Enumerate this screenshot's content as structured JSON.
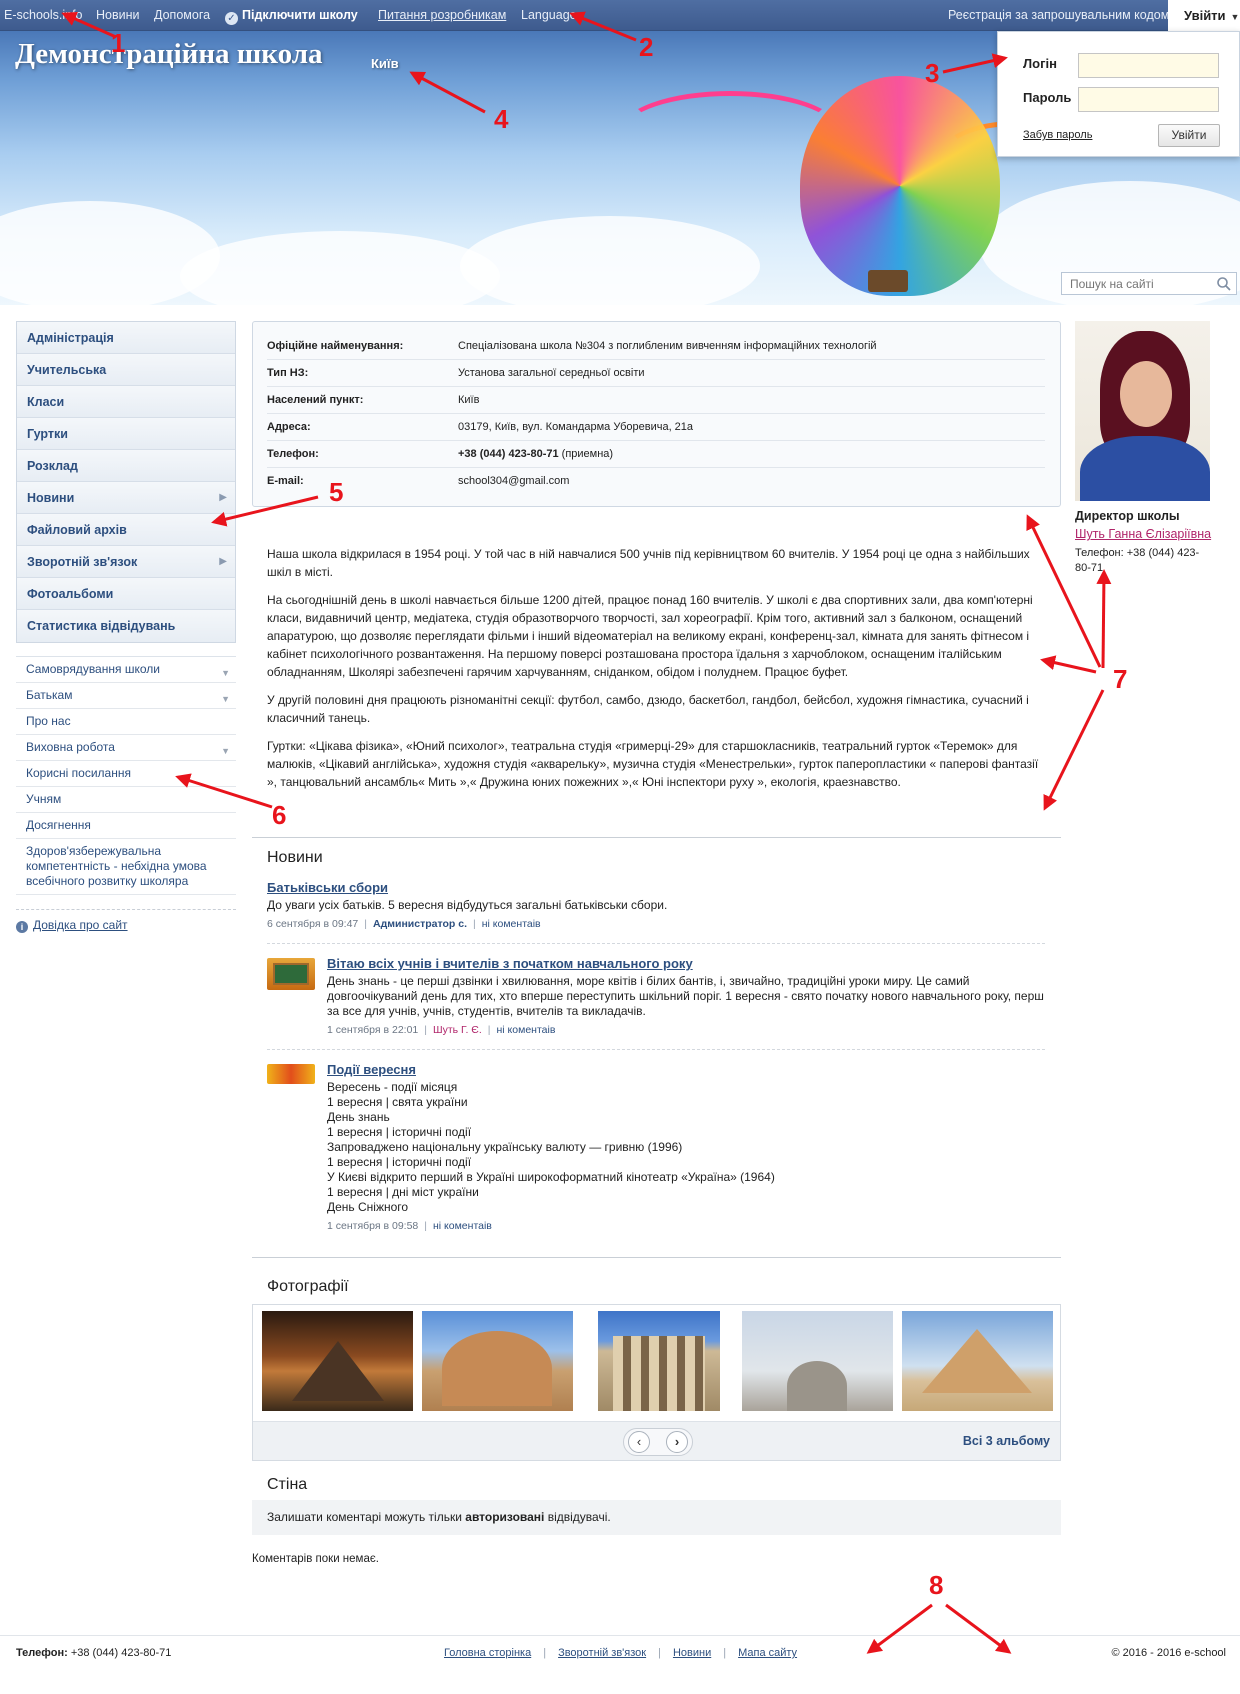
{
  "topbar": {
    "site": "E-schools.info",
    "news": "Новини",
    "help": "Допомога",
    "connect": "Підключити школу",
    "dev_questions": "Питання розробникам",
    "language": "Language",
    "register_invite": "Реєстрація за запрошувальним кодом",
    "login": "Увійти"
  },
  "school": {
    "title": "Демонстраційна школа",
    "city": "Київ"
  },
  "search": {
    "placeholder": "Пошук на сайті"
  },
  "login_form": {
    "login_label": "Логін",
    "password_label": "Пароль",
    "forgot": "Забув пароль",
    "submit": "Увійти"
  },
  "sidebar_main": [
    {
      "label": "Адміністрація"
    },
    {
      "label": "Учительська"
    },
    {
      "label": "Класи"
    },
    {
      "label": "Гуртки"
    },
    {
      "label": "Розклад"
    },
    {
      "label": "Новини"
    },
    {
      "label": "Файловий архів"
    },
    {
      "label": "Зворотній зв'язок"
    },
    {
      "label": "Фотоальбоми"
    },
    {
      "label": "Статистика відвідувань"
    }
  ],
  "sidebar_secondary": [
    {
      "label": "Самоврядування школи"
    },
    {
      "label": "Батькам"
    },
    {
      "label": "Про нас"
    },
    {
      "label": "Виховна робота"
    },
    {
      "label": "Корисні посилання"
    },
    {
      "label": "Учням"
    },
    {
      "label": "Досягнення"
    },
    {
      "label": "Здоров'язбережувальна компетентність - небхідна умова всебічного розвитку школяра"
    }
  ],
  "help_link": "Довідка про сайт",
  "info": {
    "rows": [
      {
        "key": "Офіційне найменування:",
        "value": "Спеціалізована школа №304 з поглибленим вивченням інформаційних технологій"
      },
      {
        "key": "Тип НЗ:",
        "value": "Установа загальної середньої освіти"
      },
      {
        "key": "Населений пункт:",
        "value": "Київ"
      },
      {
        "key": "Адреса:",
        "value": "03179, Київ, вул. Командарма Уборевича, 21а"
      },
      {
        "key": "Телефон:",
        "value_bold": "+38 (044) 423-80-71",
        "value_suffix": " (приемна)"
      },
      {
        "key": "E-mail:",
        "value": "school304@gmail.com"
      }
    ]
  },
  "director": {
    "title": "Директор школы",
    "name": "Шуть Ганна Єлізаріївна",
    "phone": "Телефон: +38 (044) 423-80-71"
  },
  "about": [
    "Наша школа відкрилася в 1954 році. У той час в ній навчалися 500 учнів під керівництвом 60 вчителів. У 1954 році це одна з найбільших шкіл в місті.",
    "На сьогоднішній день в школі навчається більше 1200 дітей, працює понад 160 вчителів. У школі є два спортивних зали, два комп'ютерні класи, видавничий центр, медіатека, студія образотворчого творчості, зал хореографії. Крім того, активний зал з балконом, оснащений апаратурою, що дозволяє переглядати фільми і інший відеоматеріал на великому екрані, конференц-зал, кімната для занять фітнесом і кабінет психологічного розвантаження. На першому поверсі розташована простора їдальня з харчоблоком, оснащеним італійським обладнанням, Школярі забезпечені гарячим харчуванням, сніданком, обідом і полуднем. Працює буфет.",
    "У другій половині дня працюють різноманітні секції: футбол, самбо, дзюдо, баскетбол, гандбол, бейсбол, художня гімнастика, сучасний і класичний танець.",
    "Гуртки: «Цікава фізика», «Юний психолог», театральна студія «гримерці-29» для старшокласників, театральний гурток «Теремок» для малюків, «Цікавий англійська», художня студія «акварельку», музична студія «Менестрельки», гурток паперопластики « паперові фантазії », танцювальний ансамбль« Мить »,« Дружина юних пожежних »,« Юні інспектори руху », екологія, краезнавство."
  ],
  "news": {
    "title": "Новини",
    "items": [
      {
        "title": "Батьківськи сбори",
        "body": [
          "До уваги усіх батьків. 5 вересня відбудуться загальні батьківськи сбори."
        ],
        "date": "6 сентября в 09:47",
        "author": "Администратор с.",
        "comments": "ні коментаів"
      },
      {
        "title": "Вітаю всіх учнів і вчителів з початком навчального року",
        "body": [
          "День знань - це перші дзвінки і хвилювання, море квітів і білих бантів, і, звичайно, традиційні уроки миру. Це самий довгоочікуваний день для тих, хто вперше переступить шкільний поріг. 1 вересня - свято початку нового навчального року, перш за все для учнів, учнів, студентів, вчителів та викладачів."
        ],
        "date": "1 сентября в 22:01",
        "author": "Шуть Г. Є.",
        "comments": "ні коментаів"
      },
      {
        "title": "Події вересня",
        "body": [
          "Вересень - події місяця",
          "1 вересня | свята україни",
          "День знань",
          "1 вересня | історичні події",
          "Запроваджено національну українську валюту — гривню (1996)",
          "1 вересня | історичні події",
          "У Києві відкрито перший в Україні широкоформатний кінотеатр «Україна» (1964)",
          "1 вересня | дні міст україни",
          "День Сніжного"
        ],
        "date": "1 сентября в 09:58",
        "comments": "ні коментаів"
      }
    ]
  },
  "photos": {
    "title": "Фотографії",
    "all_albums": "Всі 3 альбому"
  },
  "wall": {
    "title": "Стіна",
    "note_prefix": "Залишати коментарі можуть тільки ",
    "note_bold": "авторизовані",
    "note_suffix": " відвідувачі.",
    "no_comments": "Коментарів поки немає."
  },
  "footer": {
    "phone_label": "Телефон:",
    "phone": " +38 (044) 423-80-71",
    "links": [
      "Головна сторінка",
      "Зворотній зв'язок",
      "Новини",
      "Мапа сайту"
    ],
    "copyright": "© 2016 - 2016 e-school"
  },
  "annotations": [
    "1",
    "2",
    "3",
    "4",
    "5",
    "6",
    "7",
    "8"
  ],
  "colors": {
    "accent": "#3e5b8e",
    "link": "#2d4f7f",
    "annotation": "#e8141c",
    "pink": "#b0256a"
  }
}
